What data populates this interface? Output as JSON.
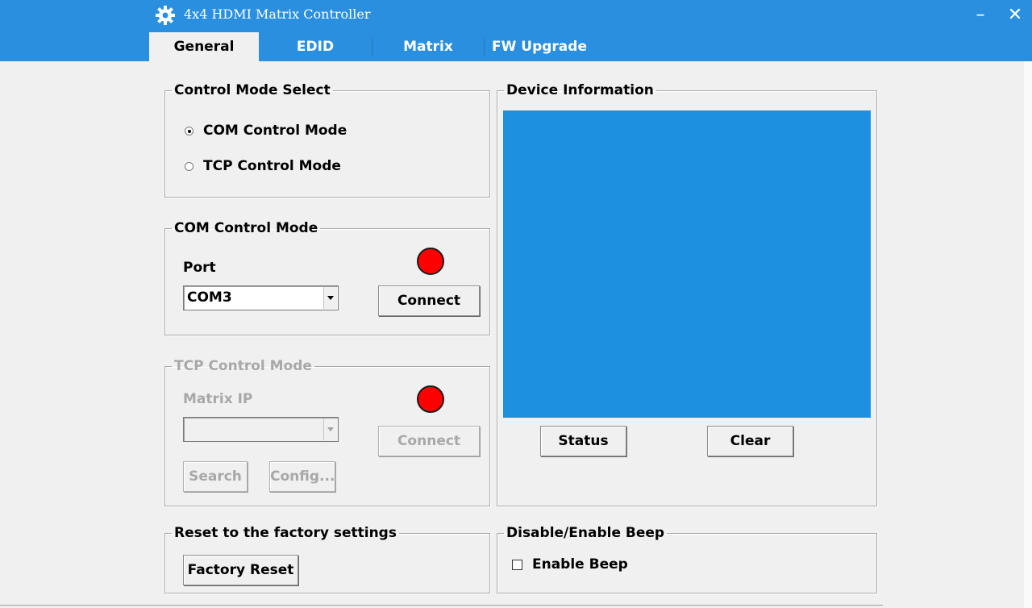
{
  "window": {
    "title": "4x4 HDMI Matrix Controller",
    "minimize": "–",
    "close": "✕",
    "accent_color": "#2b8fe0"
  },
  "tabs": [
    {
      "label": "General",
      "active": true
    },
    {
      "label": "EDID",
      "active": false
    },
    {
      "label": "Matrix",
      "active": false
    },
    {
      "label": "FW Upgrade",
      "active": false
    }
  ],
  "control_mode": {
    "legend": "Control Mode Select",
    "options": [
      {
        "label": "COM Control Mode",
        "selected": true
      },
      {
        "label": "TCP Control Mode",
        "selected": false
      }
    ]
  },
  "com_mode": {
    "legend": "COM Control Mode",
    "port_label": "Port",
    "port_value": "COM3",
    "connect_label": "Connect",
    "status_color": "#ff0000"
  },
  "tcp_mode": {
    "legend": "TCP Control Mode",
    "ip_label": "Matrix  IP",
    "ip_value": "",
    "connect_label": "Connect",
    "search_label": "Search",
    "config_label": "Config...",
    "status_color": "#ff0000",
    "enabled": false
  },
  "device_info": {
    "legend": "Device Information",
    "status_label": "Status",
    "clear_label": "Clear",
    "display_color": "#1e90e0"
  },
  "reset": {
    "legend": "Reset to the factory settings",
    "button_label": "Factory Reset"
  },
  "beep": {
    "legend": "Disable/Enable Beep",
    "checkbox_label": "Enable Beep",
    "checked": false
  }
}
